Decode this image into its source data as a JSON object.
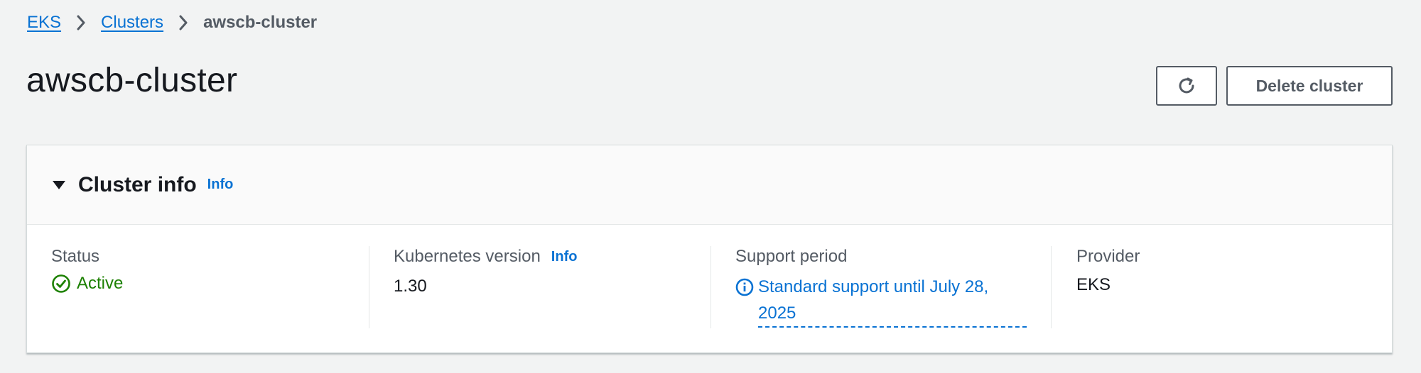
{
  "breadcrumb": {
    "items": [
      "EKS",
      "Clusters"
    ],
    "current": "awscb-cluster"
  },
  "page": {
    "title": "awscb-cluster",
    "delete_label": "Delete cluster"
  },
  "cluster_info": {
    "title": "Cluster info",
    "info_label": "Info",
    "status": {
      "label": "Status",
      "value": "Active"
    },
    "kubernetes_version": {
      "label": "Kubernetes version",
      "info_label": "Info",
      "value": "1.30"
    },
    "support_period": {
      "label": "Support period",
      "value": "Standard support until July 28, 2025"
    },
    "provider": {
      "label": "Provider",
      "value": "EKS"
    }
  },
  "colors": {
    "link": "#0972d3",
    "success": "#1d8102",
    "text": "#16191f",
    "muted": "#545b64",
    "background": "#f2f3f3"
  },
  "icons": [
    "chevron-right-icon",
    "refresh-icon",
    "caret-down-icon",
    "check-circle-icon",
    "info-circle-icon"
  ]
}
